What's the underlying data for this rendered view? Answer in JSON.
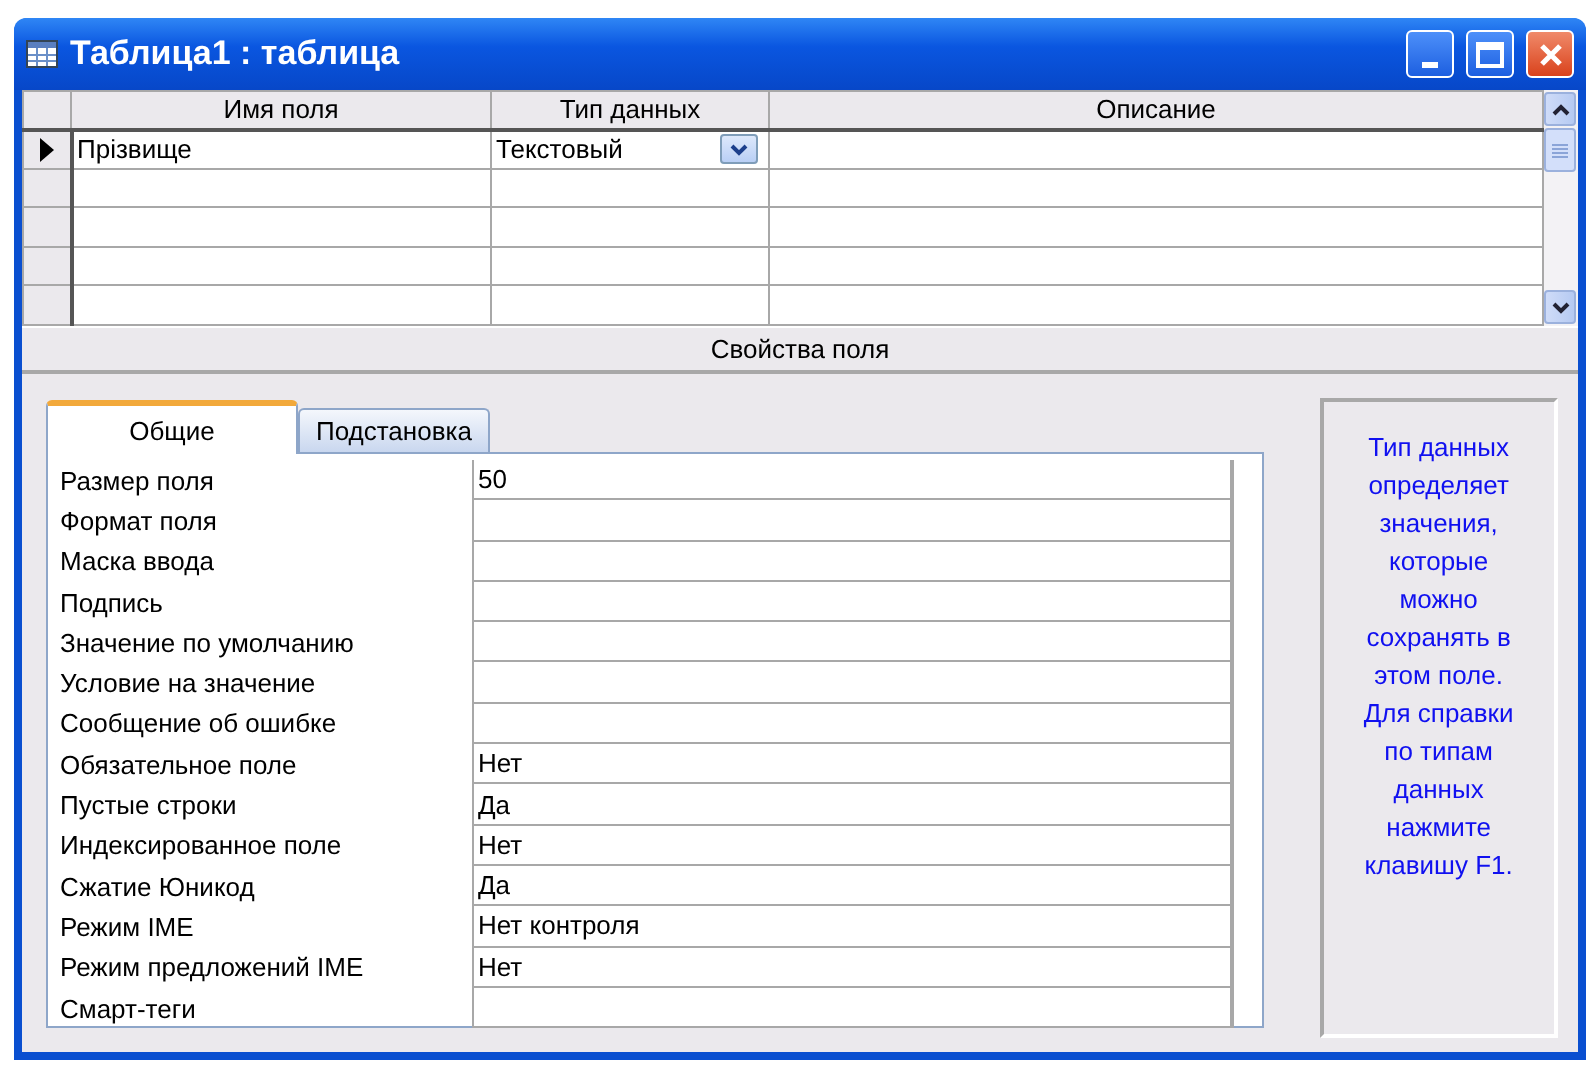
{
  "window": {
    "title": "Таблица1 : таблица"
  },
  "grid": {
    "columns": [
      "Имя поля",
      "Тип данных",
      "Описание"
    ],
    "rows": [
      {
        "name": "Прізвище",
        "type": "Текстовый",
        "selected": true
      }
    ]
  },
  "properties_title": "Свойства поля",
  "tabs": [
    {
      "label": "Общие",
      "selected": true
    },
    {
      "label": "Подстановка",
      "selected": false
    }
  ],
  "properties": [
    {
      "label": "Размер поля",
      "value": "50"
    },
    {
      "label": "Формат поля"
    },
    {
      "label": "Маска ввода"
    },
    {
      "label": "Подпись"
    },
    {
      "label": "Значение по умолчанию"
    },
    {
      "label": "Условие на значение"
    },
    {
      "label": "Сообщение об ошибке"
    },
    {
      "label": "Обязательное поле",
      "value": "Нет"
    },
    {
      "label": "Пустые строки",
      "value": "Да"
    },
    {
      "label": "Индексированное поле",
      "value": "Нет"
    },
    {
      "label": "Сжатие Юникод",
      "value": "Да"
    },
    {
      "label": "Режим IME",
      "value": "Нет контроля"
    },
    {
      "label": "Режим предложений IME",
      "value": "Нет"
    },
    {
      "label": "Смарт-теги"
    }
  ],
  "help_text": "Тип данных определяет значения, которые можно сохранять в этом поле. Для справки по типам данных нажмите клавишу F1."
}
